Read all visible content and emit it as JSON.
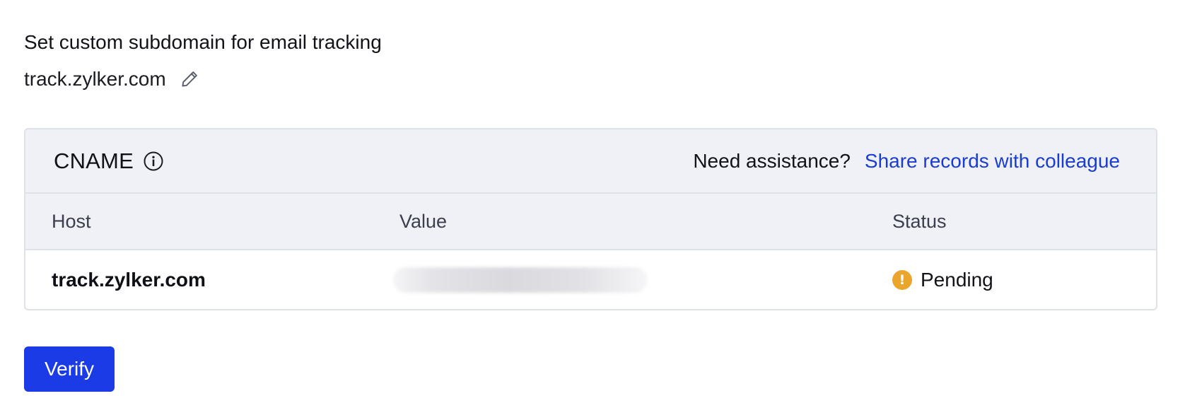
{
  "section": {
    "heading": "Set custom subdomain for email tracking",
    "subdomain": "track.zylker.com",
    "edit_icon": "pencil-icon"
  },
  "card": {
    "title": "CNAME",
    "info_icon": "info-circle-icon",
    "assist_label": "Need assistance?",
    "share_link": "Share records with colleague"
  },
  "table": {
    "columns": [
      "Host",
      "Value",
      "Status"
    ],
    "rows": [
      {
        "host": "track.zylker.com",
        "value": "",
        "status": "Pending",
        "status_icon": "warning-circle-icon"
      }
    ]
  },
  "actions": {
    "verify_label": "Verify"
  },
  "colors": {
    "accent": "#1b3be6",
    "link": "#1a3dd1",
    "pending": "#eaa52c",
    "header_bg": "#f0f1f6",
    "border": "#dfe1e8"
  }
}
